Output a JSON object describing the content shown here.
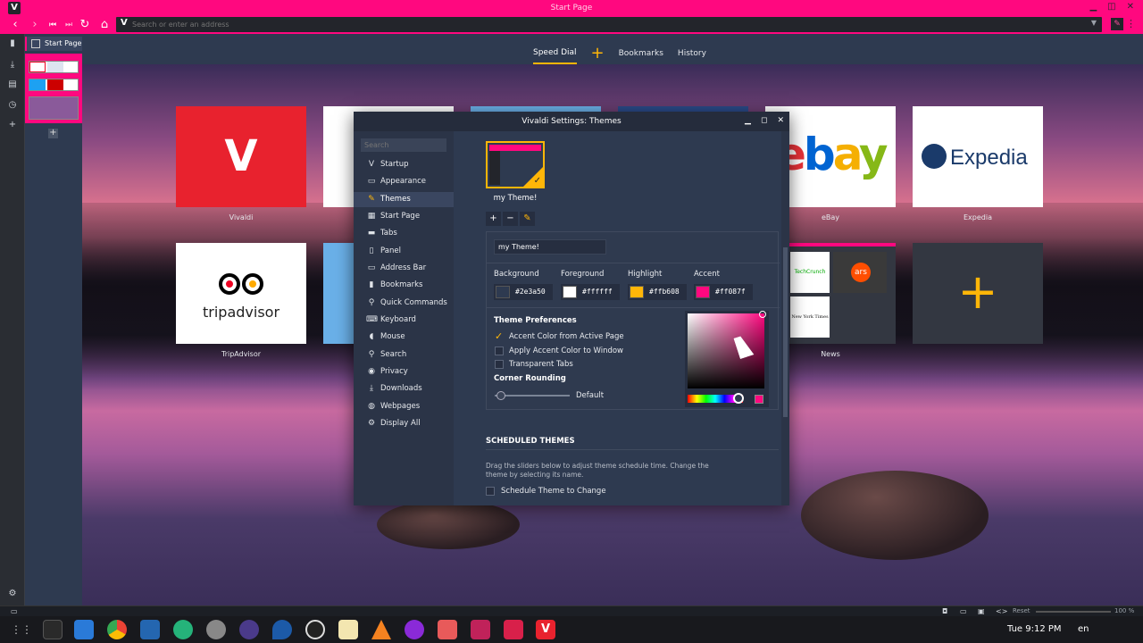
{
  "window": {
    "title": "Start Page",
    "logo": "V"
  },
  "address": {
    "placeholder": "Search or enter an address",
    "v": "V"
  },
  "tabs": {
    "active": "Start Page"
  },
  "speed_dial_tabs": [
    "Speed Dial",
    "Bookmarks",
    "History"
  ],
  "dials": [
    {
      "name": "Vivaldi",
      "label": "Vivaldi"
    },
    {
      "name": "eBay",
      "label": "eBay"
    },
    {
      "name": "Expedia",
      "label": "Expedia"
    },
    {
      "name": "TripAdvisor",
      "label": "TripAdvisor"
    },
    {
      "name": "News",
      "label": "News"
    }
  ],
  "dial_text": {
    "vivaldi_logo": "V",
    "ebay": "ebay",
    "expedia": "Expedia",
    "tripadvisor": "tripadvisor",
    "techcrunch": "TechCrunch",
    "ars": "ars",
    "nyt": "New York Times",
    "add": "+"
  },
  "dialog": {
    "title": "Vivaldi Settings: Themes",
    "search_placeholder": "Search",
    "nav": [
      "Startup",
      "Appearance",
      "Themes",
      "Start Page",
      "Tabs",
      "Panel",
      "Address Bar",
      "Bookmarks",
      "Quick Commands",
      "Keyboard",
      "Mouse",
      "Search",
      "Privacy",
      "Downloads",
      "Webpages",
      "Display All"
    ],
    "selected": "Themes",
    "theme_name": "my Theme!",
    "theme_name_value": "my Theme!",
    "colors": [
      {
        "label": "Background",
        "hex": "#2e3a50"
      },
      {
        "label": "Foreground",
        "hex": "#ffffff"
      },
      {
        "label": "Highlight",
        "hex": "#ffb608"
      },
      {
        "label": "Accent",
        "hex": "#ff087f"
      }
    ],
    "prefs_title": "Theme Preferences",
    "prefs": [
      {
        "label": "Accent Color from Active Page",
        "checked": true
      },
      {
        "label": "Apply Accent Color to Window",
        "checked": false
      },
      {
        "label": "Transparent Tabs",
        "checked": false
      }
    ],
    "corner_title": "Corner Rounding",
    "corner_value": "Default",
    "sched_title": "SCHEDULED THEMES",
    "sched_desc": "Drag the sliders below to adjust theme schedule time. Change the theme by selecting its name.",
    "sched_checkbox": "Schedule Theme to Change"
  },
  "status": {
    "reset": "Reset",
    "zoom": "100 %"
  },
  "taskbar": {
    "clock": "Tue  9:12 PM",
    "lang": "en"
  }
}
